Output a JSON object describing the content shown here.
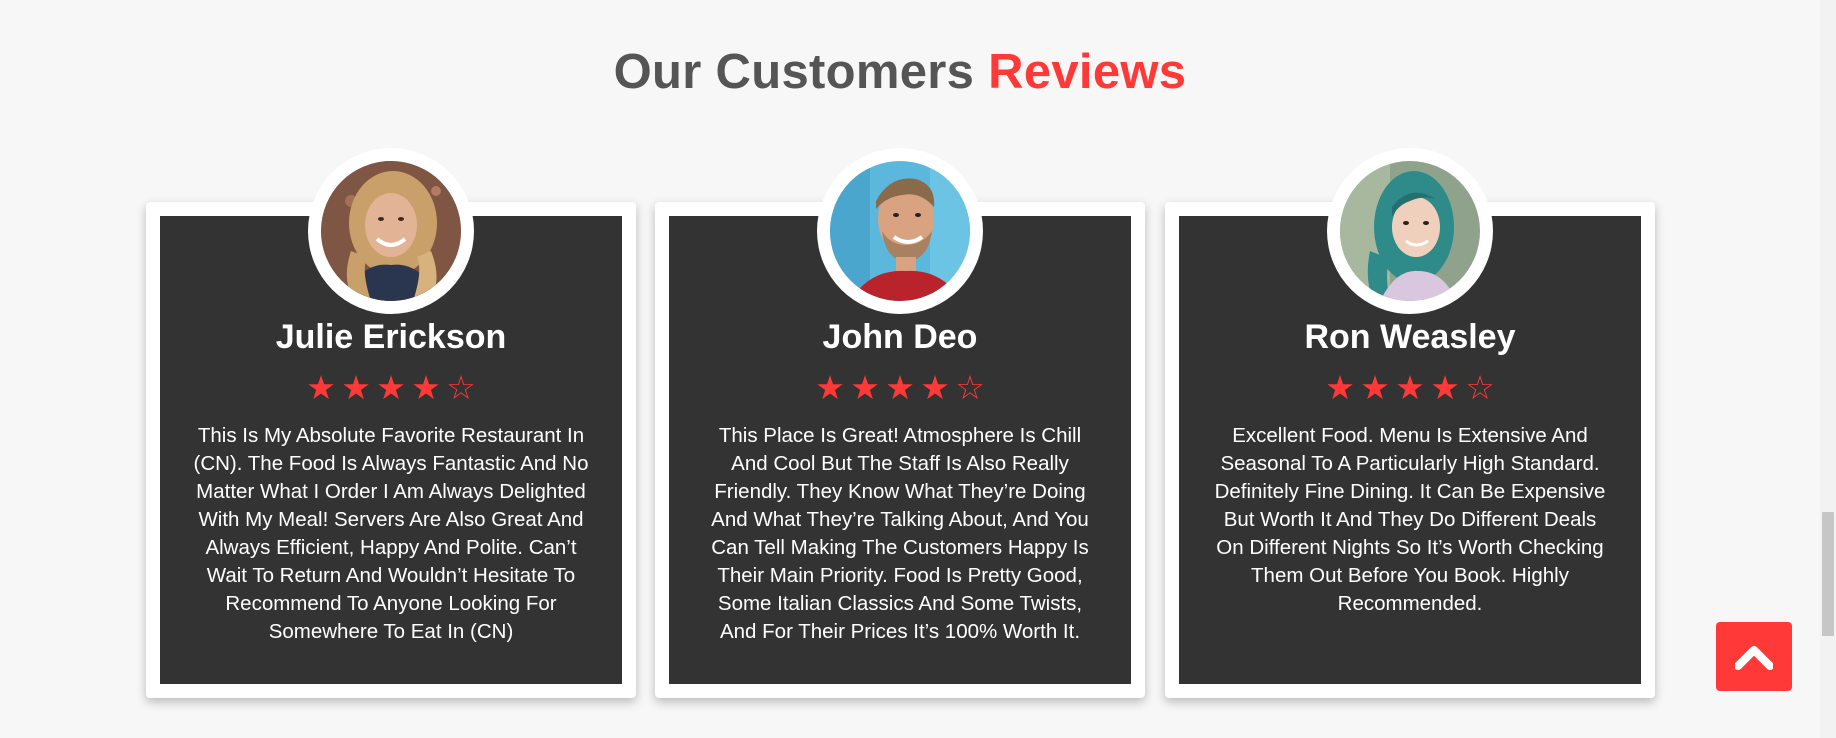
{
  "section": {
    "title_main": "Our Customers",
    "title_accent": "Reviews"
  },
  "colors": {
    "accent": "#ff3838",
    "card_bg": "#333333",
    "heading": "#555555",
    "page_bg": "#f7f7f7"
  },
  "reviews": [
    {
      "name": "Julie Erickson",
      "rating": 4,
      "max_rating": 5,
      "stars": [
        "★",
        "★",
        "★",
        "★",
        "☆"
      ],
      "avatar": "woman-curly-hair-avatar",
      "text": "This Is My Absolute Favorite Restaurant In (CN). The Food Is Always Fantastic And No Matter What I Order I Am Always Delighted With My Meal! Servers Are Also Great And Always Efficient, Happy And Polite. Can’t Wait To Return And Wouldn’t Hesitate To Recommend To Anyone Looking For Somewhere To Eat In (CN)"
    },
    {
      "name": "John Deo",
      "rating": 4,
      "max_rating": 5,
      "stars": [
        "★",
        "★",
        "★",
        "★",
        "☆"
      ],
      "avatar": "bearded-man-avatar",
      "text": "This Place Is Great! Atmosphere Is Chill And Cool But The Staff Is Also Really Friendly. They Know What They’re Doing And What They’re Talking About, And You Can Tell Making The Customers Happy Is Their Main Priority. Food Is Pretty Good, Some Italian Classics And Some Twists, And For Their Prices It’s 100% Worth It."
    },
    {
      "name": "Ron Weasley",
      "rating": 4,
      "max_rating": 5,
      "stars": [
        "★",
        "★",
        "★",
        "★",
        "☆"
      ],
      "avatar": "teal-hair-woman-avatar",
      "text": "Excellent Food. Menu Is Extensive And Seasonal To A Particularly High Standard. Definitely Fine Dining. It Can Be Expensive But Worth It And They Do Different Deals On Different Nights So It’s Worth Checking Them Out Before You Book. Highly Recommended."
    }
  ],
  "scroll_top_button": {
    "icon": "chevron-up-icon"
  }
}
